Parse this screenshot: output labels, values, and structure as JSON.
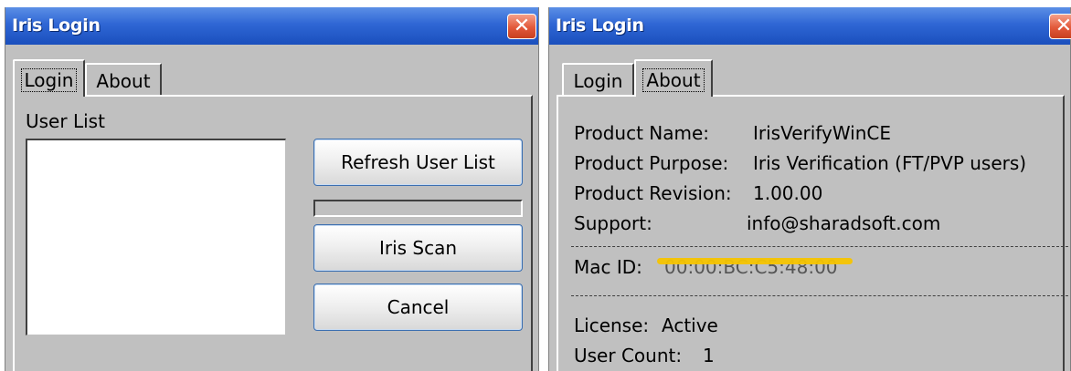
{
  "login_window": {
    "title": "Iris Login",
    "tabs": [
      {
        "label": "Login",
        "active": true
      },
      {
        "label": "About",
        "active": false
      }
    ],
    "user_list_label": "User List",
    "user_list_items": [],
    "buttons": {
      "refresh": "Refresh User List",
      "iris_scan": "Iris Scan",
      "cancel": "Cancel"
    },
    "progress_fraction": 0
  },
  "about_window": {
    "title": "Iris Login",
    "tabs": [
      {
        "label": "Login",
        "active": false
      },
      {
        "label": "About",
        "active": true
      }
    ],
    "fields": [
      {
        "label": "Product Name:",
        "value": "IrisVerifyWinCE"
      },
      {
        "label": "Product Purpose:",
        "value": "Iris Verification (FT/PVP users)"
      },
      {
        "label": "Product Revision:",
        "value": "1.00.00"
      },
      {
        "label": "Support:",
        "value": "info@sharadsoft.com"
      }
    ],
    "mac_id": {
      "label": "Mac ID:",
      "value": "00:00:BC:C5:48:00",
      "redacted": true
    },
    "license": {
      "label": "License:",
      "value": "Active"
    },
    "user_count": {
      "label": "User Count:",
      "value": "1"
    }
  },
  "colors": {
    "title_bar": "#2f66d4",
    "close_button": "#e2593a",
    "dialog_background": "#c0c0c0",
    "redaction_marker": "#f5c400"
  },
  "icons": {
    "close": "close-icon"
  }
}
